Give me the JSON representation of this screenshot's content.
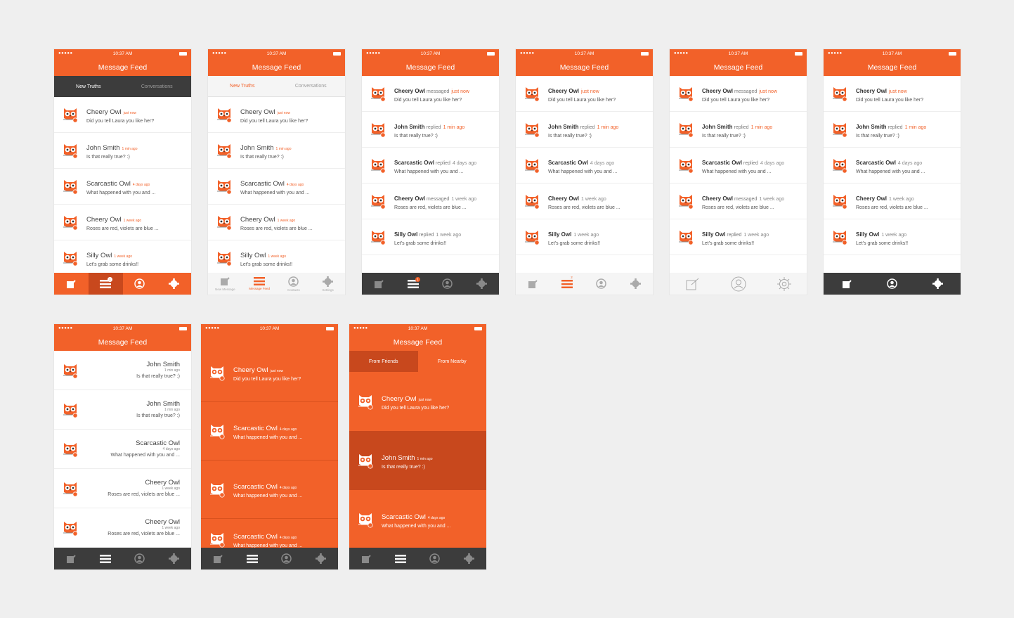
{
  "colors": {
    "accent": "#f26129",
    "dark": "#3c3c3c",
    "accent_dark": "#c8481d"
  },
  "status": {
    "dots": "●●●●●",
    "time": "10:37 AM"
  },
  "title": "Message Feed",
  "segments_a": {
    "left": "New Truths",
    "right": "Conversations"
  },
  "segments_b": {
    "left": "From Friends",
    "right": "From Nearby"
  },
  "feed_short": [
    {
      "name": "Cheery Owl",
      "time": "just now",
      "msg": "Did you tell Laura you like her?"
    },
    {
      "name": "John Smith",
      "time": "1 min ago",
      "msg": "Is that really true? :)"
    },
    {
      "name": "Scarcastic Owl",
      "time": "4 days ago",
      "msg": "What happened with you and ..."
    },
    {
      "name": "Cheery Owl",
      "time": "1 week ago",
      "msg": "Roses are red, violets are blue ..."
    },
    {
      "name": "Silly Owl",
      "time": "1 week ago",
      "msg": "Let's grab some drinks!!"
    }
  ],
  "feed_verbose": [
    {
      "name": "Cheery Owl",
      "verb": "messaged",
      "time": "just now",
      "msg": "Did you tell Laura you like her?"
    },
    {
      "name": "John Smith",
      "verb": "replied",
      "time": "1 min ago",
      "msg": "Is that really true? :)"
    },
    {
      "name": "Scarcastic Owl",
      "verb": "replied",
      "time": "4 days ago",
      "msg": "What happened with you and ..."
    },
    {
      "name": "Cheery Owl",
      "verb": "messaged",
      "time": "1 week ago",
      "msg": "Roses are red, violets are blue ..."
    },
    {
      "name": "Silly Owl",
      "verb": "replied",
      "time": "1 week ago",
      "msg": "Let's grab some drinks!!"
    }
  ],
  "feed_right": [
    {
      "name": "John Smith",
      "time": "1 min ago",
      "msg": "Is that really true? :)"
    },
    {
      "name": "John Smith",
      "time": "1 min ago",
      "msg": "Is that really true? :)"
    },
    {
      "name": "Scarcastic Owl",
      "time": "4 days ago",
      "msg": "What happened with you and ..."
    },
    {
      "name": "Cheery Owl",
      "time": "1 week ago",
      "msg": "Roses are red, violets are blue ..."
    },
    {
      "name": "Cheery Owl",
      "time": "1 week ago",
      "msg": "Roses are red, violets are blue ..."
    }
  ],
  "feed_orange_8": [
    {
      "name": "Cheery Owl",
      "time": "just now",
      "msg": "Did you tell Laura you like her?"
    },
    {
      "name": "Scarcastic Owl",
      "time": "4 days ago",
      "msg": "What happened with you and ..."
    },
    {
      "name": "Scarcastic Owl",
      "time": "4 days ago",
      "msg": "What happened with you and ..."
    },
    {
      "name": "Scarcastic Owl",
      "time": "4 days ago",
      "msg": "What happened with you and ..."
    }
  ],
  "feed_orange_9": [
    {
      "name": "Cheery Owl",
      "time": "just now",
      "msg": "Did you tell Laura you like her?"
    },
    {
      "name": "John Smith",
      "time": "1 min ago",
      "msg": "Is that really true? :)"
    },
    {
      "name": "Scarcastic Owl",
      "time": "4 days ago",
      "msg": "What happened with you and ..."
    }
  ],
  "tab_labels": [
    "New Message",
    "Message Feed",
    "Contacts",
    "Settings"
  ],
  "badges": {
    "s1": "1",
    "s3": "1",
    "s4": "2"
  }
}
